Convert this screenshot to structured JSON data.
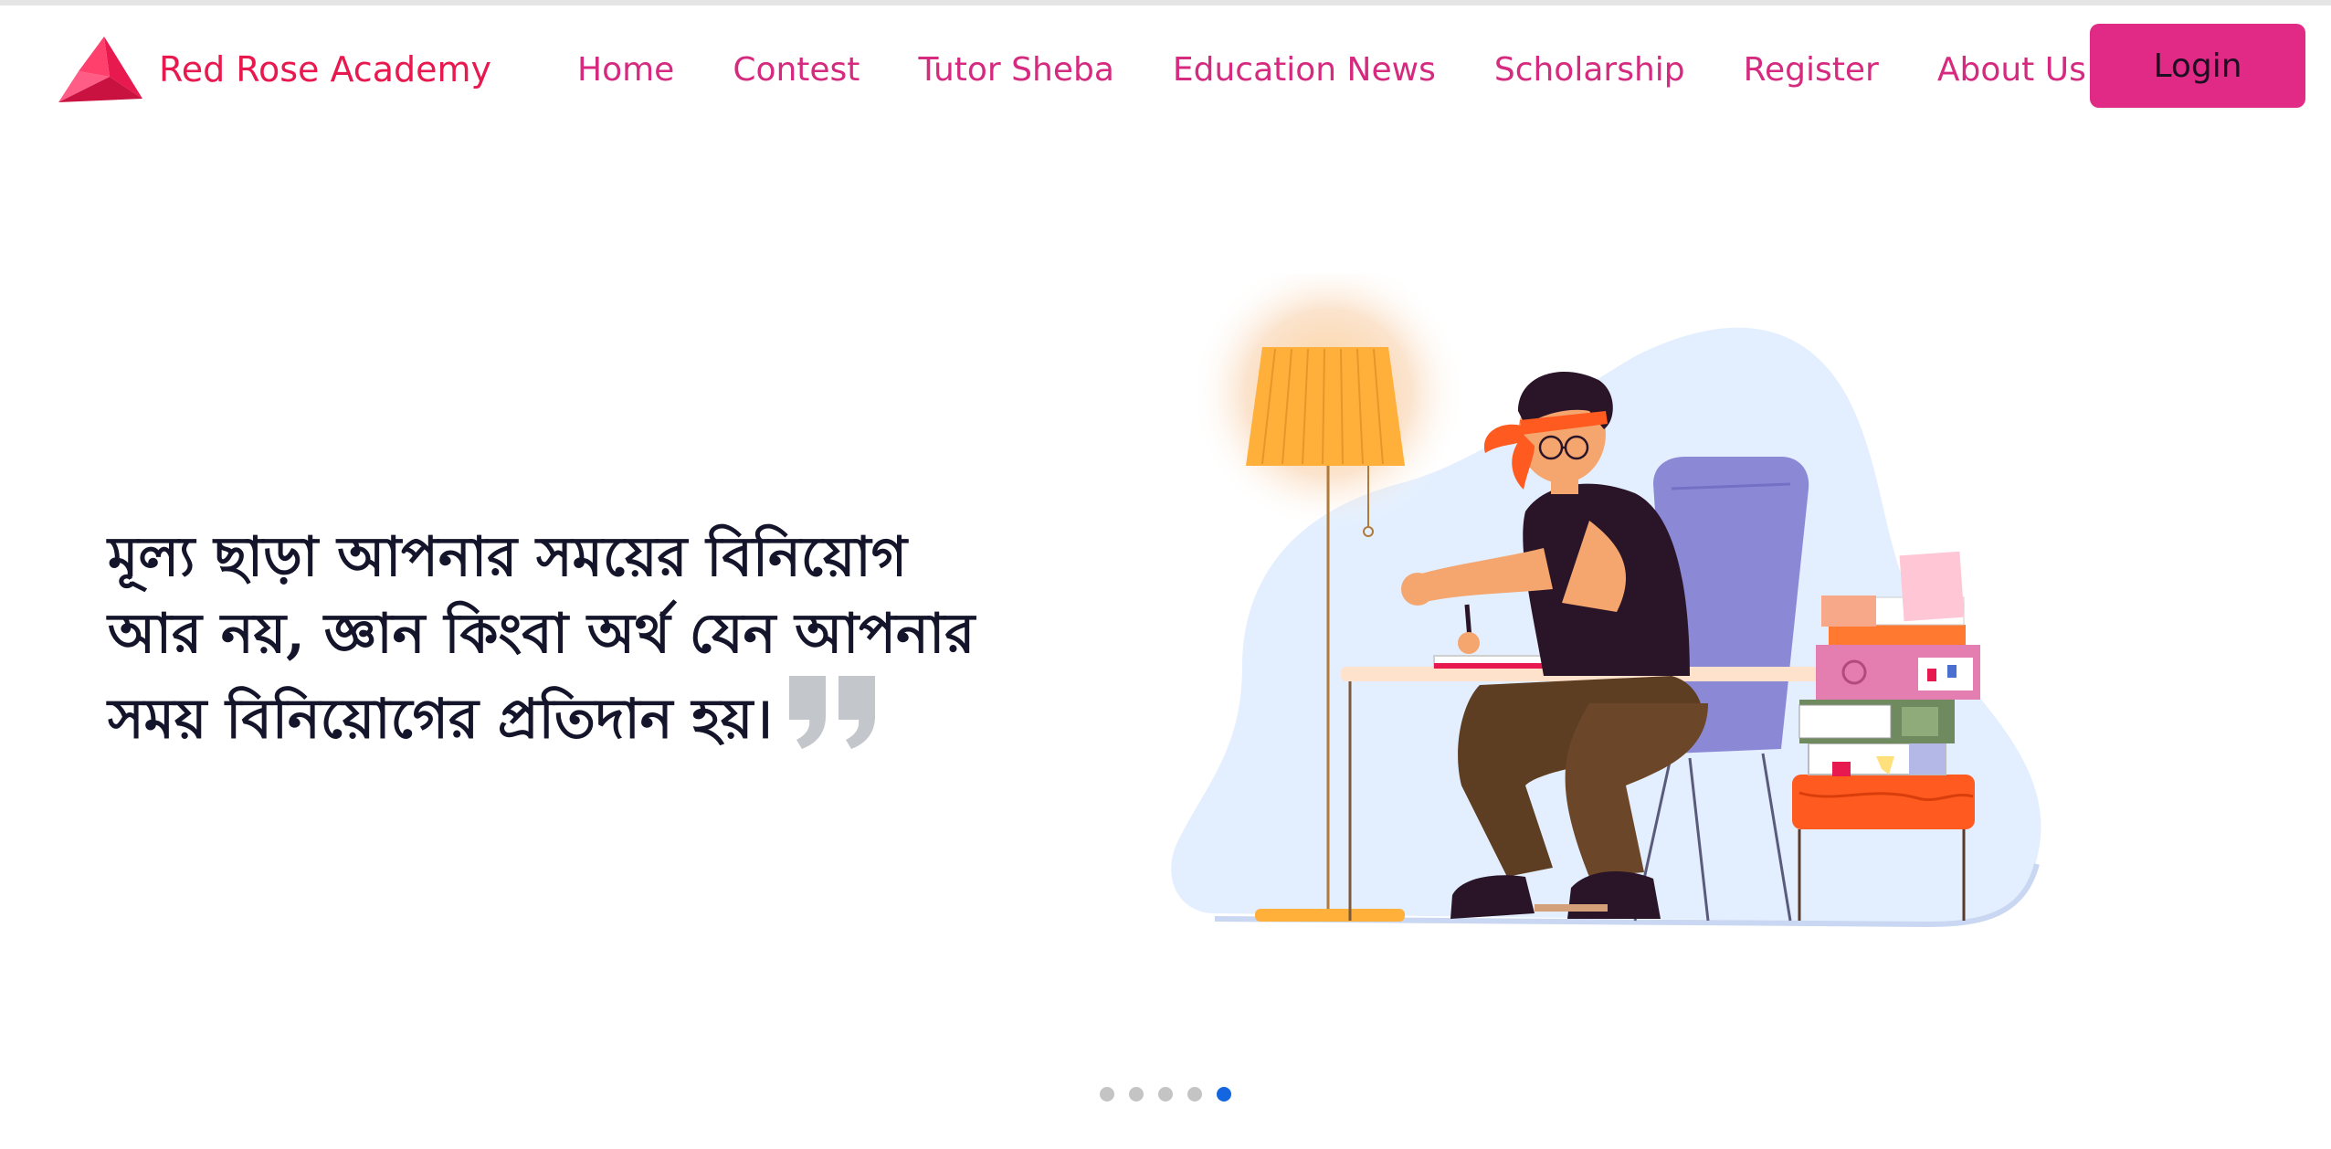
{
  "brand": {
    "name": "Red Rose Academy",
    "logo_icon": "red-rose-triangle-logo",
    "color": "#e8194f"
  },
  "nav": {
    "items": [
      {
        "label": "Home"
      },
      {
        "label": "Contest"
      },
      {
        "label": "Tutor Sheba"
      },
      {
        "label": "Education News"
      },
      {
        "label": "Scholarship"
      },
      {
        "label": "Register"
      },
      {
        "label": "About Us"
      }
    ],
    "link_color": "#d52a7f"
  },
  "login": {
    "label": "Login",
    "bg_color": "#e02a85"
  },
  "hero": {
    "quote_lines": [
      "মূল্য ছাড়া আপনার সময়ের বিনিয়োগ",
      "আর নয়, জ্ঞান কিংবা অর্থ যেন আপনার",
      "সময় বিনিয়োগের প্রতিদান হয়।"
    ],
    "quote_icon": "closing-quote-icon",
    "illustration": "student-studying-at-desk-illustration"
  },
  "carousel": {
    "slide_count": 5,
    "active_index": 4,
    "active_color": "#1466e0"
  }
}
